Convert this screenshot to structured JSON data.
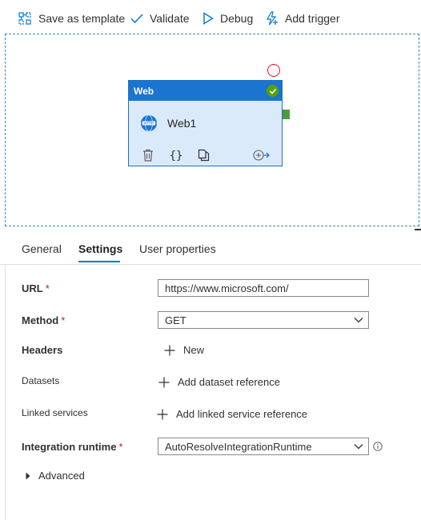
{
  "toolbar": {
    "save_template": "Save as template",
    "validate": "Validate",
    "debug": "Debug",
    "add_trigger": "Add trigger"
  },
  "activity": {
    "type": "Web",
    "name": "Web1",
    "icon": "http-globe-icon",
    "status": "succeeded",
    "colors": {
      "header": "#1b74d0",
      "body": "#dbeafb",
      "status": "#57a300"
    }
  },
  "tabs": [
    {
      "label": "General",
      "active": false
    },
    {
      "label": "Settings",
      "active": true
    },
    {
      "label": "User properties",
      "active": false
    }
  ],
  "form": {
    "url": {
      "label": "URL",
      "required": "*",
      "value": "https://www.microsoft.com/"
    },
    "method": {
      "label": "Method",
      "required": "*",
      "value": "GET"
    },
    "headers": {
      "label": "Headers",
      "action": "New"
    },
    "datasets": {
      "label": "Datasets",
      "action": "Add dataset reference"
    },
    "linked_services": {
      "label": "Linked services",
      "action": "Add linked service reference"
    },
    "integration_runtime": {
      "label": "Integration runtime",
      "required": "*",
      "value": "AutoResolveIntegrationRuntime"
    },
    "advanced": {
      "label": "Advanced"
    }
  },
  "colors": {
    "accent": "#0078d4",
    "required": "#a4262c",
    "canvas_border": "#2f86c8"
  }
}
